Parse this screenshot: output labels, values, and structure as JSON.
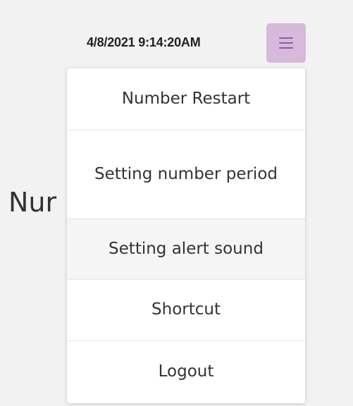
{
  "header": {
    "datetime": "4/8/2021 9:14:20AM"
  },
  "menu_button": {
    "icon": "hamburger-menu-icon",
    "background_color": "#d7b9db",
    "icon_color": "#8a5fa2"
  },
  "background": {
    "partial_text": "Nur"
  },
  "dropdown": {
    "items": [
      {
        "label": "Number Restart"
      },
      {
        "label": "Setting number period"
      },
      {
        "label": "Setting alert sound",
        "highlighted": true
      },
      {
        "label": "Shortcut"
      },
      {
        "label": "Logout"
      }
    ]
  }
}
